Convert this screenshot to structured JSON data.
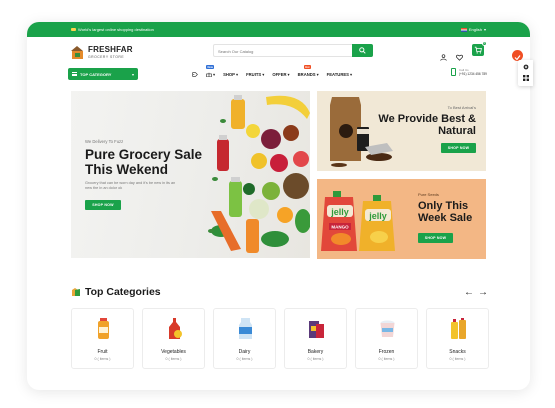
{
  "topbar": {
    "promo_text": "World's largest online shopping destination",
    "language": "English"
  },
  "brand": {
    "name": "FRESHFAR",
    "tagline": "GROCERY STORE"
  },
  "search": {
    "placeholder": "Search Our Catalog"
  },
  "header": {
    "cart_count": "0"
  },
  "nav": {
    "category_button": "TOP CATEGORY",
    "items": [
      {
        "label": "SHOP",
        "badge": ""
      },
      {
        "label": "FRUITS",
        "badge": ""
      },
      {
        "label": "OFFER",
        "badge": ""
      },
      {
        "label": "BRANDS",
        "badge": "Hot"
      },
      {
        "label": "FEATURES",
        "badge": ""
      }
    ],
    "icon_badge": "New"
  },
  "contact": {
    "label": "Call Us",
    "number": "(+91) 1234 456 789"
  },
  "hero": {
    "kicker": "We Delivery To Fuzz",
    "title": "Pure Grocery Sale This Wekend",
    "description": "Grocery that can be worn day and it's be new in its an new the in an dolor ok",
    "button": "SHOP NOW"
  },
  "banner_coffee": {
    "kicker": "To Best Arrival's",
    "title": "We Provide Best & Natural",
    "button": "SHOP NOW"
  },
  "banner_jelly": {
    "kicker": "Pure Seeds",
    "title": "Only This Week Sale",
    "button": "SHOP NOW",
    "pouch_text": "jelly",
    "pouch_sub": "MANGO"
  },
  "categories": {
    "heading": "Top Categories",
    "prev": "←",
    "next": "→",
    "items": [
      {
        "name": "Fruit",
        "count": "0 ( items )"
      },
      {
        "name": "Vegetables",
        "count": "0 ( items )"
      },
      {
        "name": "Dairy",
        "count": "0 ( items )"
      },
      {
        "name": "Bakery",
        "count": "0 ( items )"
      },
      {
        "name": "Frozen",
        "count": "0 ( items )"
      },
      {
        "name": "Snacks",
        "count": "0 ( items )"
      }
    ]
  },
  "colors": {
    "accent": "#1aa24a",
    "hero_bg": "#f0efec",
    "coffee_bg": "#f1e8d6",
    "jelly_bg": "#f3b785",
    "hot_badge": "#f04e23",
    "new_badge": "#2f6fd6"
  }
}
